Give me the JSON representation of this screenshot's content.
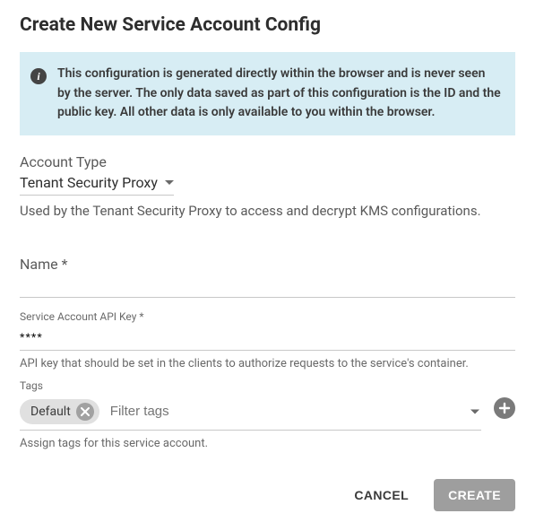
{
  "title": "Create New Service Account Config",
  "info_banner": "This configuration is generated directly within the browser and is never seen by the server. The only data saved as part of this configuration is the ID and the public key. All other data is only available to you within the browser.",
  "account_type": {
    "label": "Account Type",
    "value": "Tenant Security Proxy",
    "helper": "Used by the Tenant Security Proxy to access and decrypt KMS configurations."
  },
  "name_field": {
    "label": "Name *",
    "value": ""
  },
  "api_key": {
    "label": "Service Account API Key *",
    "value": "****",
    "helper": "API key that should be set in the clients to authorize requests to the service's container."
  },
  "tags": {
    "label": "Tags",
    "chips": [
      "Default"
    ],
    "placeholder": "Filter tags",
    "helper": "Assign tags for this service account."
  },
  "actions": {
    "cancel": "CANCEL",
    "create": "CREATE"
  }
}
